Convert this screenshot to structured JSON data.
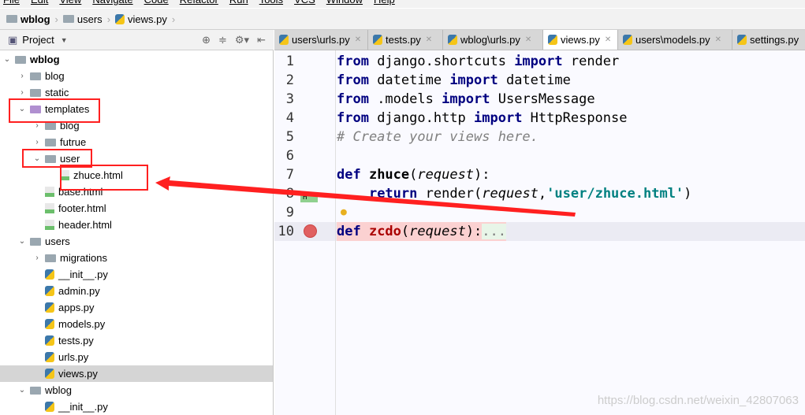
{
  "menu": [
    "File",
    "Edit",
    "View",
    "Navigate",
    "Code",
    "Refactor",
    "Run",
    "Tools",
    "VCS",
    "Window",
    "Help"
  ],
  "breadcrumb": [
    "wblog",
    "users",
    "views.py"
  ],
  "project": {
    "label": "Project"
  },
  "tabs": [
    "users\\urls.py",
    "tests.py",
    "wblog\\urls.py",
    "views.py",
    "users\\models.py",
    "settings.py"
  ],
  "active_tab": "views.py",
  "tree": [
    {
      "label": "wblog",
      "type": "folder",
      "indent": 0,
      "open": true,
      "bold": true
    },
    {
      "label": "blog",
      "type": "folder",
      "indent": 1
    },
    {
      "label": "static",
      "type": "folder",
      "indent": 1
    },
    {
      "label": "templates",
      "type": "folder",
      "indent": 1,
      "open": true,
      "purple": true
    },
    {
      "label": "blog",
      "type": "folder",
      "indent": 2
    },
    {
      "label": "futrue",
      "type": "folder",
      "indent": 2
    },
    {
      "label": "user",
      "type": "folder",
      "indent": 2,
      "open": true
    },
    {
      "label": "zhuce.html",
      "type": "html",
      "indent": 3
    },
    {
      "label": "base.html",
      "type": "html",
      "indent": 2
    },
    {
      "label": "footer.html",
      "type": "html",
      "indent": 2
    },
    {
      "label": "header.html",
      "type": "html",
      "indent": 2
    },
    {
      "label": "users",
      "type": "folder",
      "indent": 1,
      "open": true
    },
    {
      "label": "migrations",
      "type": "folder",
      "indent": 2
    },
    {
      "label": "__init__.py",
      "type": "py",
      "indent": 2
    },
    {
      "label": "admin.py",
      "type": "py",
      "indent": 2
    },
    {
      "label": "apps.py",
      "type": "py",
      "indent": 2
    },
    {
      "label": "models.py",
      "type": "py",
      "indent": 2
    },
    {
      "label": "tests.py",
      "type": "py",
      "indent": 2
    },
    {
      "label": "urls.py",
      "type": "py",
      "indent": 2
    },
    {
      "label": "views.py",
      "type": "py",
      "indent": 2,
      "selected": true
    },
    {
      "label": "wblog",
      "type": "folder",
      "indent": 1,
      "open": true
    },
    {
      "label": "__init__.py",
      "type": "py",
      "indent": 2
    }
  ],
  "code": {
    "l1": [
      "from",
      " django.shortcuts ",
      "import",
      " render"
    ],
    "l2": [
      "from",
      " datetime ",
      "import",
      " datetime"
    ],
    "l3": [
      "from",
      " .models ",
      "import",
      " UsersMessage"
    ],
    "l4": [
      "from",
      " django.http ",
      "import",
      " HttpResponse"
    ],
    "l6": "# Create your views here.",
    "l7": [
      "def ",
      "zhuce",
      "(",
      "request",
      "):"
    ],
    "l8": [
      "    ",
      "return",
      " render(",
      "request",
      ",",
      "'user/zhuce.html'",
      ")"
    ],
    "l10": [
      "def ",
      "zcdo",
      "(",
      "request",
      "):",
      "..."
    ]
  },
  "line_numbers": [
    "1",
    "2",
    "3",
    "4",
    "5",
    "6",
    "7",
    "8",
    "9",
    "10"
  ],
  "watermark": "https://blog.csdn.net/weixin_42807063",
  "colors": {
    "annotation": "#ff2020",
    "breakpoint": "#e06060"
  }
}
